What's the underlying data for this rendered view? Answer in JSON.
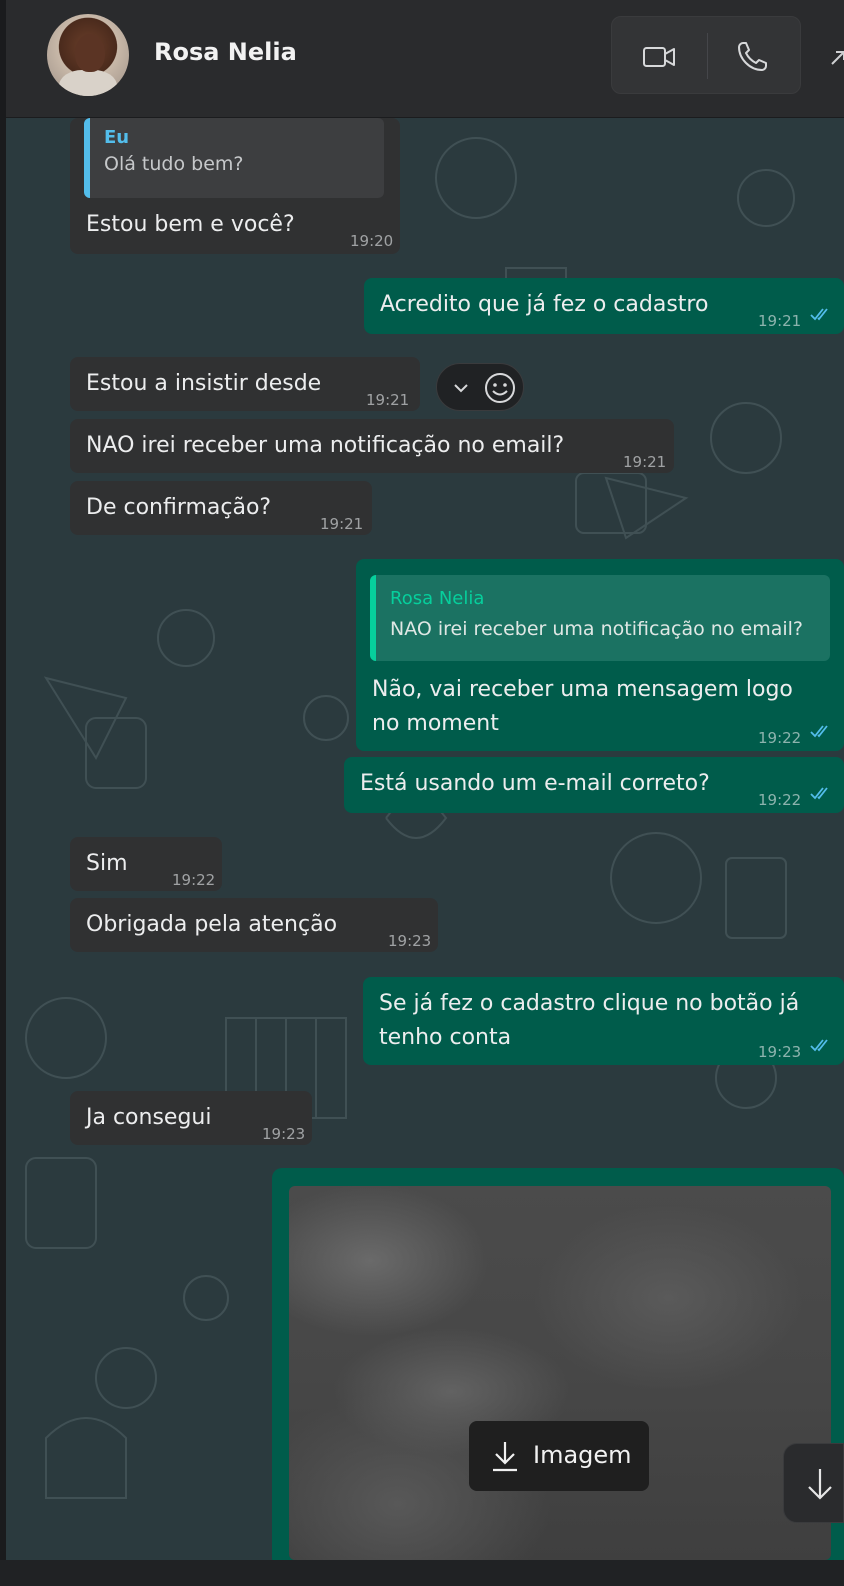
{
  "header": {
    "contact_name": "Rosa Nelia",
    "video_call_icon": "video-camera-icon",
    "voice_call_icon": "phone-icon"
  },
  "messages": [
    {
      "dir": "in",
      "quote_author": "Eu",
      "quote_text": "Olá tudo bem?",
      "text": "Estou bem e você?",
      "time": "19:20"
    },
    {
      "dir": "out",
      "text": "Acredito que já fez o cadastro",
      "time": "19:21",
      "read": true
    },
    {
      "dir": "in",
      "text": "Estou a insistir desde",
      "time": "19:21"
    },
    {
      "dir": "in",
      "text": "NAO irei receber uma notificação no email?",
      "time": "19:21"
    },
    {
      "dir": "in",
      "text": "De confirmação?",
      "time": "19:21"
    },
    {
      "dir": "out",
      "quote_author": "Rosa Nelia",
      "quote_text": "NAO irei receber uma notificação no email?",
      "text_line1": "Não, vai receber uma mensagem logo",
      "text_line2": "no moment",
      "time": "19:22",
      "read": true
    },
    {
      "dir": "out",
      "text": "Está usando um e-mail correto?",
      "time": "19:22",
      "read": true
    },
    {
      "dir": "in",
      "text": "Sim",
      "time": "19:22"
    },
    {
      "dir": "in",
      "text": "Obrigada pela atenção",
      "time": "19:23"
    },
    {
      "dir": "out",
      "text_line1": "Se já fez o cadastro clique no botão já",
      "text_line2": "tenho conta",
      "time": "19:23",
      "read": true
    },
    {
      "dir": "in",
      "text": "Ja consegui",
      "time": "19:23"
    }
  ],
  "image_message": {
    "download_label": "Imagem",
    "download_icon": "download-arrow-icon"
  },
  "colors": {
    "incoming_bubble": "#303132",
    "outgoing_bubble": "#005c4b",
    "chat_background": "#2b3a3e",
    "quote_mine_accent": "#53bdeb",
    "quote_contact_accent": "#06cf9c",
    "read_ticks": "#53bdeb"
  }
}
